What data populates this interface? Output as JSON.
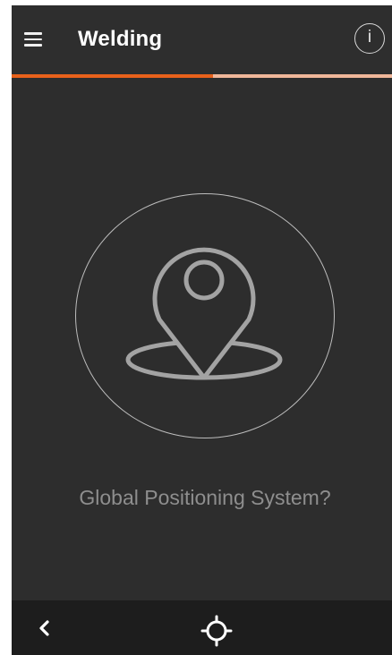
{
  "app_bar": {
    "title": "Welding",
    "menu_icon": "hamburger-menu-icon",
    "info_label": "i",
    "info_icon": "info-icon"
  },
  "progress": {
    "value": 0.53,
    "fill_color": "#e8611b",
    "track_color": "#f0b79a"
  },
  "main": {
    "icon": "map-pin-location-icon",
    "question": "Global Positioning System?"
  },
  "nav_bar": {
    "back_icon": "chevron-left-icon",
    "locate_icon": "crosshair-locate-icon"
  },
  "colors": {
    "background": "#2d2d2d",
    "nav_background": "#1d1d1d",
    "accent": "#e8611b",
    "text_muted": "#8e8e8e"
  }
}
